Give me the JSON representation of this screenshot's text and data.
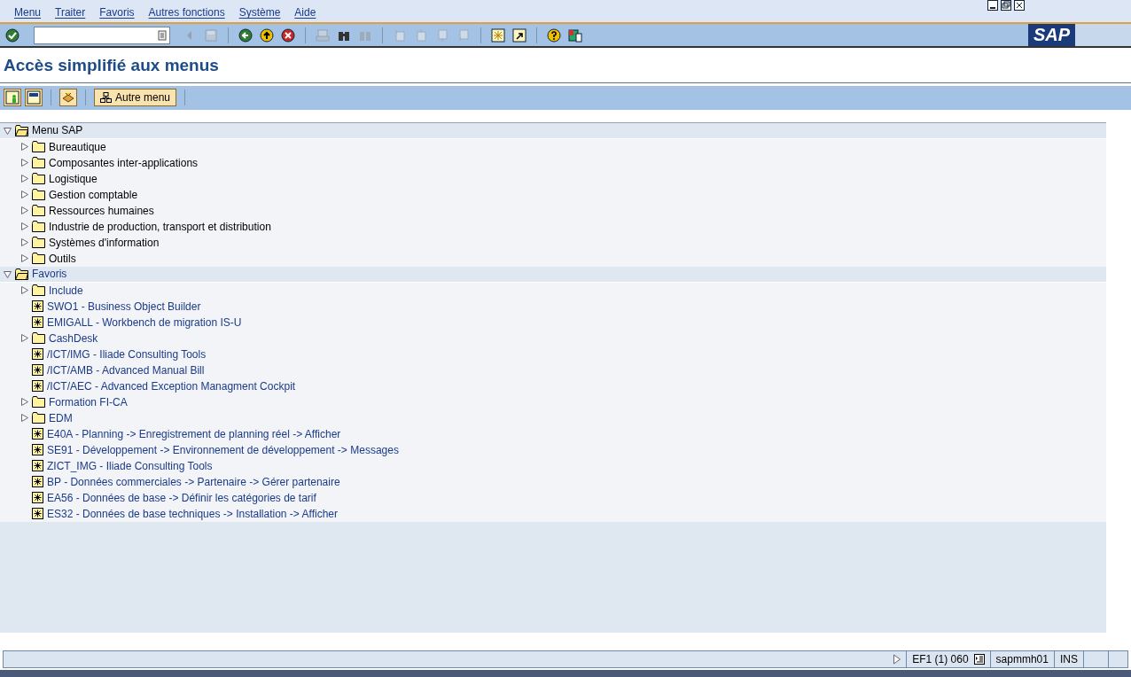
{
  "menu_bar": [
    "Menu",
    "Traiter",
    "Favoris",
    "Autres fonctions",
    "Système",
    "Aide"
  ],
  "logo": "SAP",
  "toolbar": {
    "buttons": [
      {
        "disabled": false
      },
      {
        "disabled": true
      },
      {
        "disabled": true
      },
      {
        "disabled": false
      },
      {
        "disabled": false
      },
      {
        "disabled": false
      },
      {
        "disabled": true
      },
      {
        "disabled": false
      },
      {
        "disabled": true
      },
      {
        "disabled": true
      },
      {
        "disabled": true
      },
      {
        "disabled": true
      },
      {
        "disabled": true
      },
      {
        "disabled": false
      },
      {
        "disabled": false
      },
      {
        "disabled": false
      },
      {
        "disabled": false
      }
    ]
  },
  "page_title": "Accès simplifié aux menus",
  "app_toolbar": {
    "button_label": "Autre menu"
  },
  "tree": [
    {
      "label": "Menu SAP",
      "kind": "menu",
      "expanded": true,
      "children": [
        {
          "label": "Bureautique",
          "kind": "folder",
          "expanded": false
        },
        {
          "label": "Composantes inter-applications",
          "kind": "folder",
          "expanded": false
        },
        {
          "label": "Logistique",
          "kind": "folder",
          "expanded": false
        },
        {
          "label": "Gestion comptable",
          "kind": "folder",
          "expanded": false
        },
        {
          "label": "Ressources humaines",
          "kind": "folder",
          "expanded": false
        },
        {
          "label": "Industrie de production, transport et distribution",
          "kind": "folder",
          "expanded": false
        },
        {
          "label": "Systèmes d'information",
          "kind": "folder",
          "expanded": false
        },
        {
          "label": "Outils",
          "kind": "folder",
          "expanded": false
        }
      ]
    },
    {
      "label": "Favoris",
      "kind": "favorites",
      "expanded": true,
      "children": [
        {
          "label": "Include",
          "kind": "folder",
          "expanded": false
        },
        {
          "label": "SWO1 - Business Object Builder",
          "kind": "transaction"
        },
        {
          "label": "EMIGALL - Workbench de migration IS-U",
          "kind": "transaction"
        },
        {
          "label": "CashDesk",
          "kind": "folder",
          "expanded": false
        },
        {
          "label": "/ICT/IMG - Iliade Consulting Tools",
          "kind": "transaction"
        },
        {
          "label": "/ICT/AMB - Advanced Manual Bill",
          "kind": "transaction"
        },
        {
          "label": "/ICT/AEC - Advanced Exception Managment Cockpit",
          "kind": "transaction"
        },
        {
          "label": "Formation FI-CA",
          "kind": "folder",
          "expanded": false
        },
        {
          "label": "EDM",
          "kind": "folder",
          "expanded": false
        },
        {
          "label": "E40A - Planning -> Enregistrement de planning réel -> Afficher",
          "kind": "transaction"
        },
        {
          "label": "SE91 - Développement -> Environnement de développement -> Messages",
          "kind": "transaction"
        },
        {
          "label": "ZICT_IMG - Iliade Consulting Tools",
          "kind": "transaction"
        },
        {
          "label": "BP - Données commerciales -> Partenaire -> Gérer partenaire",
          "kind": "transaction"
        },
        {
          "label": "EA56 - Données de base -> Définir les catégories de tarif",
          "kind": "transaction"
        },
        {
          "label": "ES32 - Données de base techniques -> Installation -> Afficher",
          "kind": "transaction"
        }
      ]
    }
  ],
  "status_bar": {
    "system": "EF1 (1) 060",
    "server": "sapmmh01",
    "mode": "INS"
  }
}
